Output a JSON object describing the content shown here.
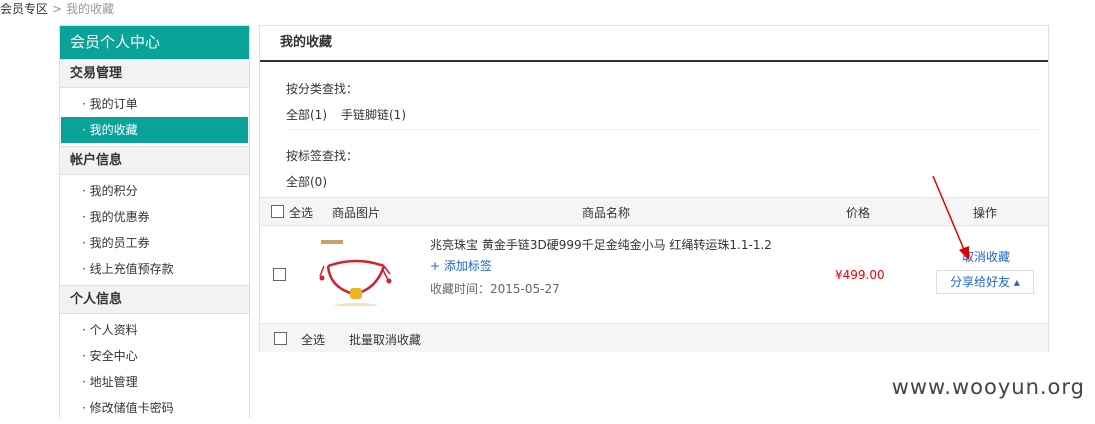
{
  "breadcrumb": {
    "root": "会员专区",
    "sep": ">",
    "current": "我的收藏"
  },
  "sidebar": {
    "title": "会员个人中心",
    "sections": [
      {
        "title": "交易管理",
        "items": [
          "· 我的订单",
          "· 我的收藏"
        ]
      },
      {
        "title": "帐户信息",
        "items": [
          "· 我的积分",
          "· 我的优惠券",
          "· 我的员工券",
          "· 线上充值预存款"
        ]
      },
      {
        "title": "个人信息",
        "items": [
          "· 个人资料",
          "· 安全中心",
          "· 地址管理",
          "· 修改储值卡密码"
        ]
      }
    ],
    "active_item": "· 我的收藏"
  },
  "main": {
    "title": "我的收藏",
    "category_label": "按分类查找：",
    "categories": [
      "全部(1)",
      "手链脚链(1)"
    ],
    "tag_label": "按标签查找：",
    "tags": [
      "全部(0)"
    ],
    "table_headers": {
      "select_all": "全选",
      "image": "商品图片",
      "name": "商品名称",
      "price": "价格",
      "action": "操作"
    },
    "items": [
      {
        "name": "兆亮珠宝 黄金手链3D硬999千足金纯金小马 红绳转运珠1.1-1.2",
        "add_tag": "+ 添加标签",
        "time": "收藏时间：2015-05-27",
        "price": "¥499.00",
        "cancel": "取消收藏",
        "share": "分享给好友 ▴"
      }
    ],
    "footer": {
      "select_all": "全选",
      "batch_cancel": "批量取消收藏"
    }
  },
  "watermark": "www.wooyun.org",
  "colors": {
    "accent": "#0aa39a",
    "link": "#2266cc",
    "price": "#e00000",
    "arrow": "#e00000"
  }
}
